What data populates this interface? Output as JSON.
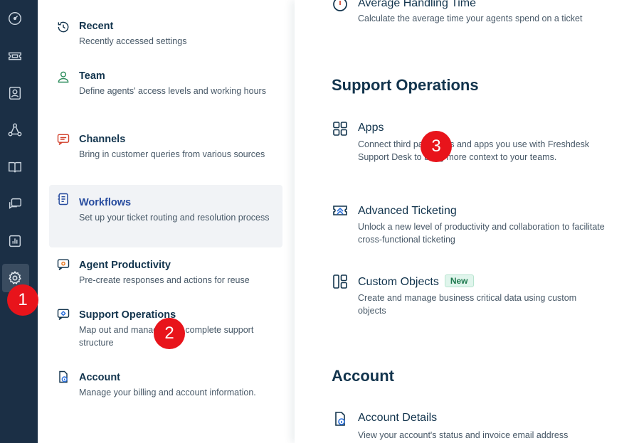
{
  "rail": {
    "items": [
      {
        "icon": "dashboard-icon"
      },
      {
        "icon": "ticket-icon"
      },
      {
        "icon": "contacts-icon"
      },
      {
        "icon": "network-icon"
      },
      {
        "icon": "knowledge-base-icon"
      },
      {
        "icon": "chat-icon"
      },
      {
        "icon": "reports-icon"
      },
      {
        "icon": "settings-icon",
        "active": true
      }
    ]
  },
  "menu": {
    "items": [
      {
        "title": "Recent",
        "desc": "Recently accessed settings",
        "icon": "history-icon"
      },
      {
        "title": "Team",
        "desc": "Define agents' access levels and working hours",
        "icon": "team-icon"
      },
      {
        "title": "Channels",
        "desc": "Bring in customer queries from various sources",
        "icon": "channels-icon"
      },
      {
        "title": "Workflows",
        "desc": "Set up your ticket routing and resolution process",
        "icon": "workflows-icon",
        "active": true
      },
      {
        "title": "Agent Productivity",
        "desc": "Pre-create responses and actions for reuse",
        "icon": "agent-productivity-icon"
      },
      {
        "title": "Support Operations",
        "desc": "Map out and manage your complete support structure",
        "icon": "support-operations-icon"
      },
      {
        "title": "Account",
        "desc": "Manage your billing and account information.",
        "icon": "account-icon"
      }
    ]
  },
  "content": {
    "top_item": {
      "title": "Average Handling Time",
      "desc": "Calculate the average time your agents spend on a ticket",
      "icon": "clock-icon"
    },
    "sections": [
      {
        "title": "Support Operations",
        "items": [
          {
            "title": "Apps",
            "desc": "Connect third party tools and apps you use with Freshdesk Support Desk to bring more context to your teams.",
            "icon": "apps-grid-icon"
          },
          {
            "title": "Advanced Ticketing",
            "desc": "Unlock a new level of productivity and collaboration to facilitate cross-functional ticketing",
            "icon": "advanced-ticketing-icon"
          },
          {
            "title": "Custom Objects",
            "badge": "New",
            "desc": "Create and manage business critical data using custom objects",
            "icon": "custom-objects-icon"
          }
        ]
      },
      {
        "title": "Account",
        "items": [
          {
            "title": "Account Details",
            "desc": "View your account's status and invoice email address",
            "icon": "account-details-icon"
          }
        ]
      }
    ]
  },
  "markers": [
    "1",
    "2",
    "3"
  ],
  "colors": {
    "rail_bg": "#1b2f45",
    "active_title": "#264b9e",
    "marker": "#e8141b",
    "icon_teal": "#2c7a7b"
  }
}
